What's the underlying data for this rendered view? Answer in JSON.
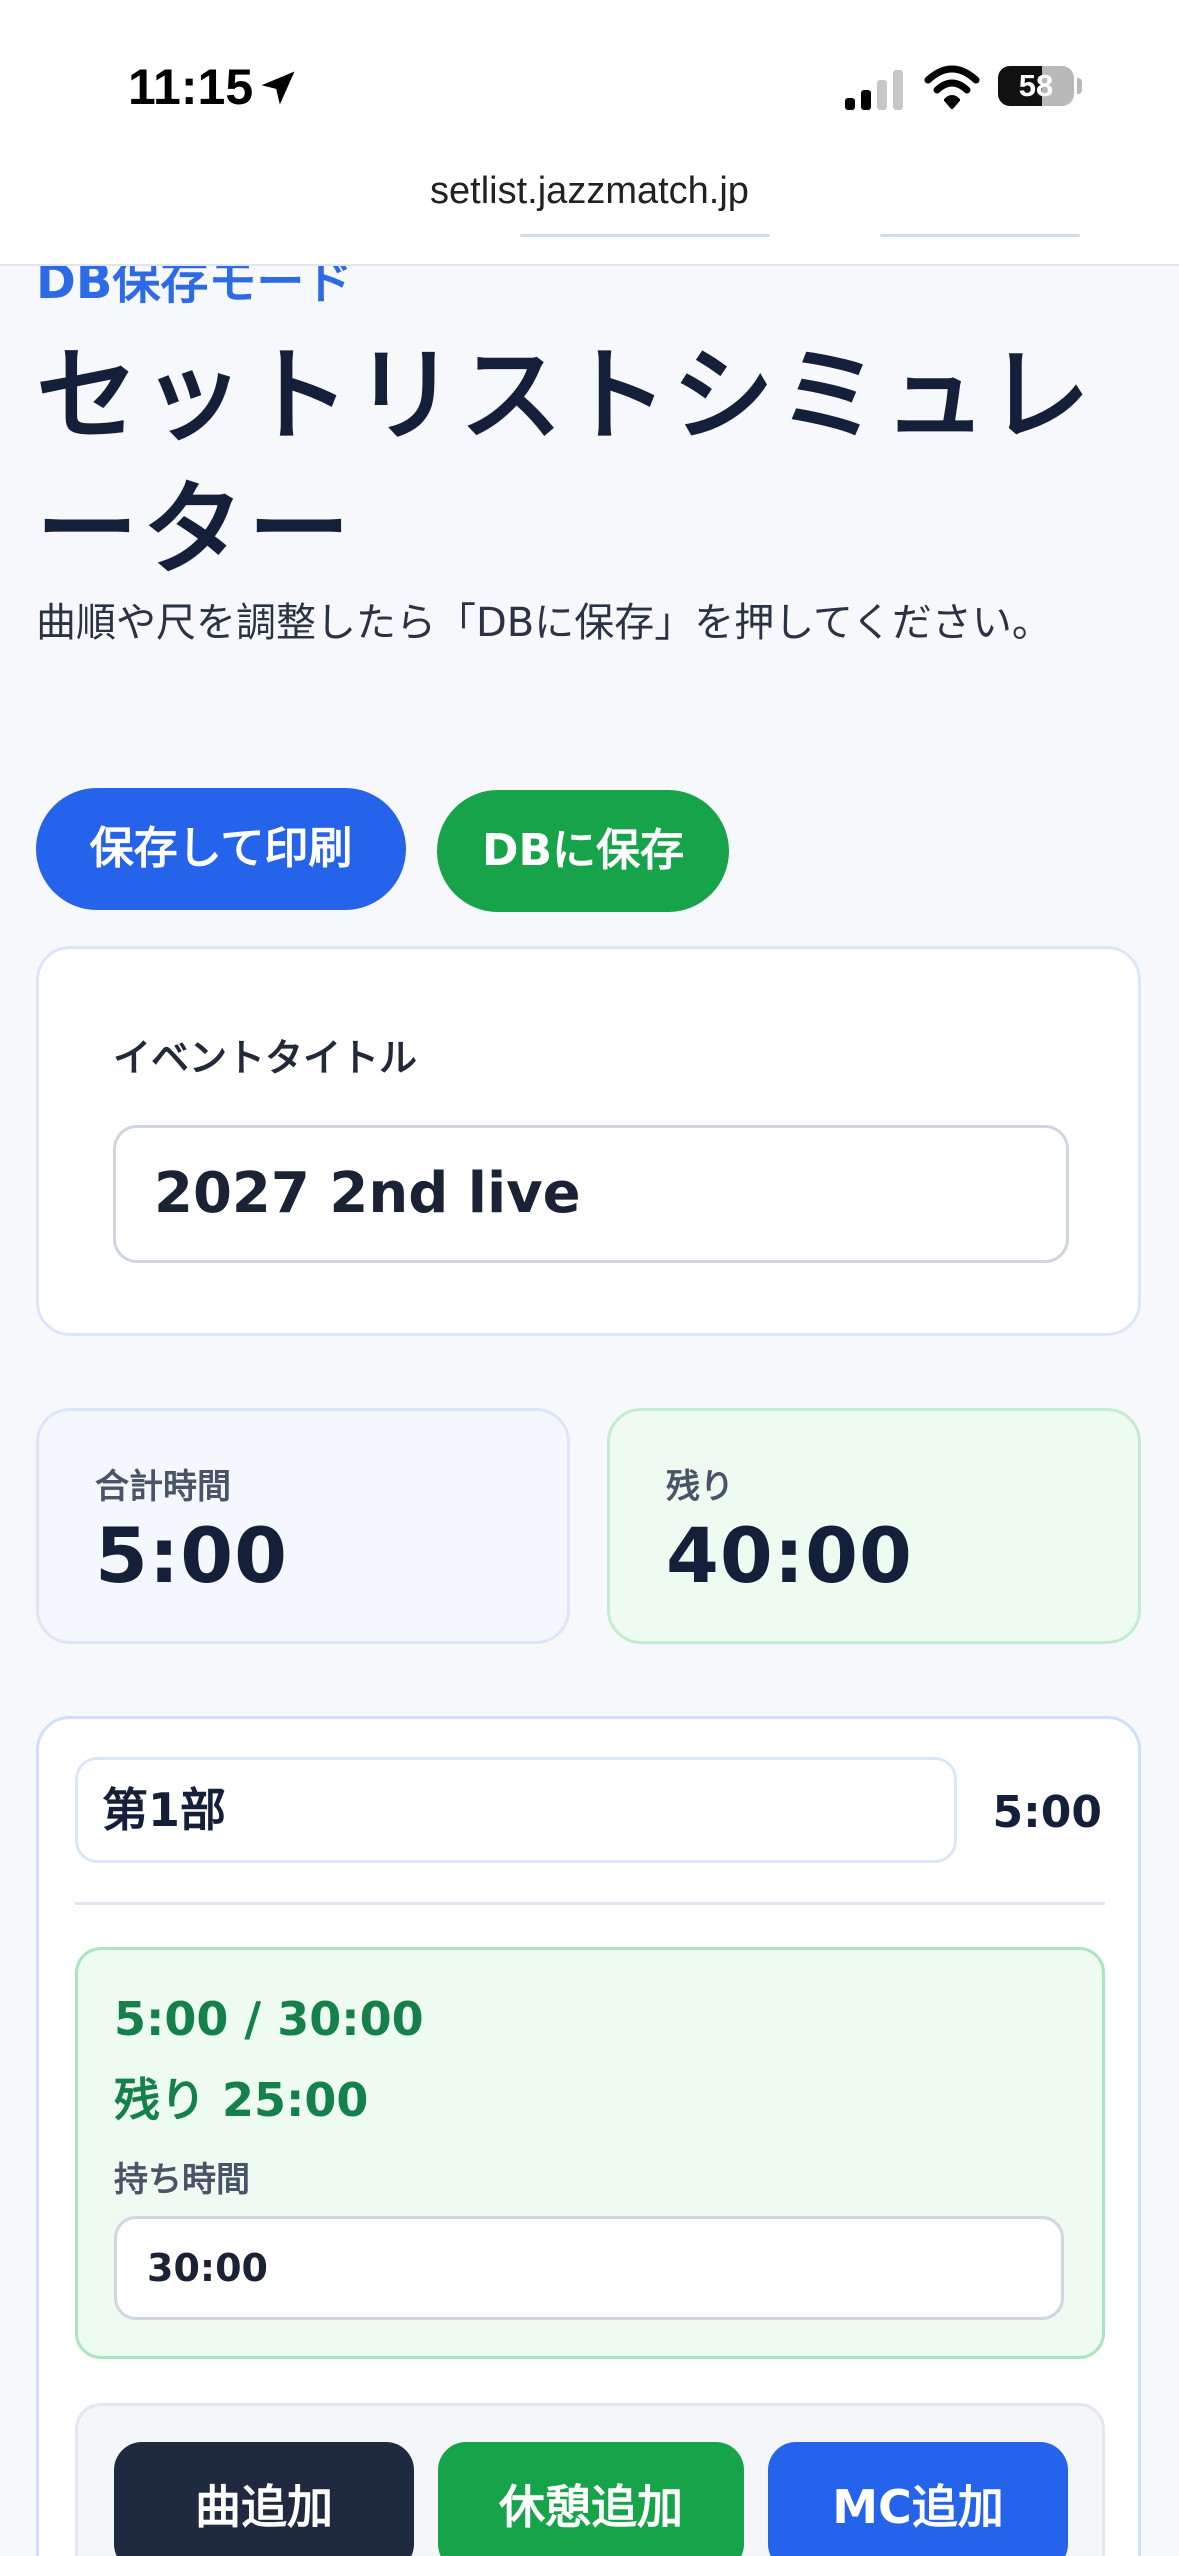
{
  "status_bar": {
    "time": "11:15",
    "battery": "58",
    "battery_level": 0.58
  },
  "browser": {
    "url": "setlist.jazzmatch.jp"
  },
  "page": {
    "mode_tag": "DB保存モード",
    "title": "セットリストシミュレーター",
    "description": "曲順や尺を調整したら「DBに保存」を押してください。"
  },
  "actions": {
    "save_print": "保存して印刷",
    "save_db": "DBに保存"
  },
  "event": {
    "label": "イベントタイトル",
    "value": "2027 2nd live"
  },
  "summary": {
    "total_label": "合計時間",
    "total_value": "5:00",
    "remaining_label": "残り",
    "remaining_value": "40:00"
  },
  "section": {
    "name": "第1部",
    "duration": "5:00",
    "allocation": {
      "usage": "5:00 / 30:00",
      "remaining": "残り 25:00",
      "label": "持ち時間",
      "value": "30:00"
    },
    "buttons": {
      "add_song": "曲追加",
      "add_break": "休憩追加",
      "add_mc": "MC追加"
    }
  },
  "colors": {
    "primary_blue": "#2563eb",
    "success_green": "#16a34a",
    "dark_navy": "#1f2a40"
  }
}
